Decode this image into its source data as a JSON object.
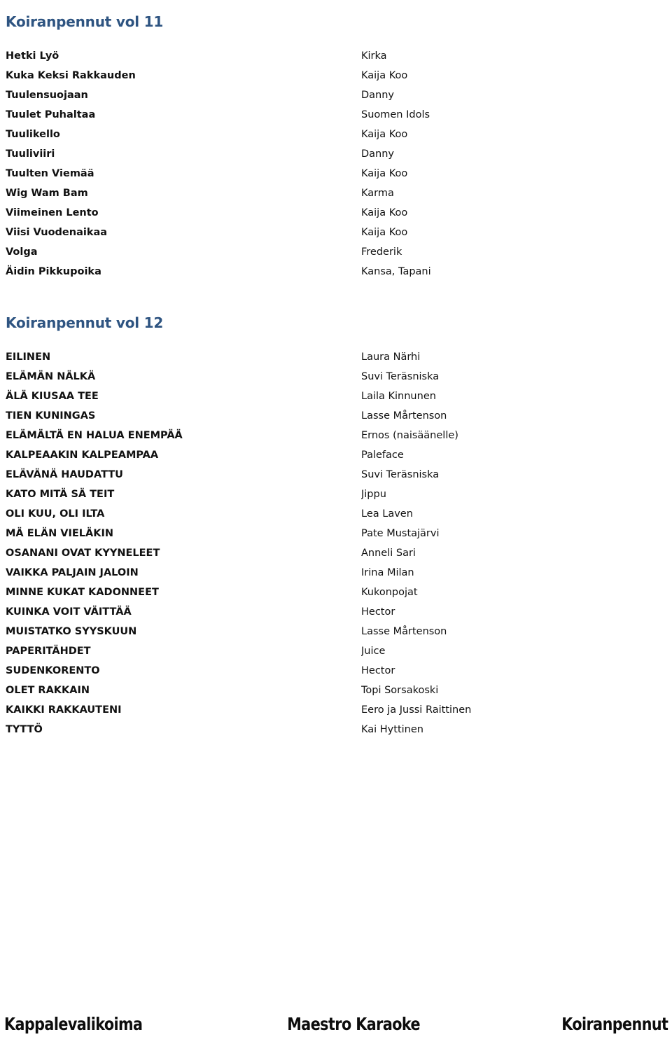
{
  "document": {
    "sections": [
      {
        "id": "vol11",
        "title": "Koiranpennut vol 11",
        "tracks": [
          {
            "title": "Hetki Lyö",
            "artist": "Kirka"
          },
          {
            "title": "Kuka Keksi Rakkauden",
            "artist": "Kaija Koo"
          },
          {
            "title": "Tuulensuojaan",
            "artist": "Danny"
          },
          {
            "title": "Tuulet Puhaltaa",
            "artist": "Suomen Idols"
          },
          {
            "title": "Tuulikello",
            "artist": "Kaija Koo"
          },
          {
            "title": "Tuuliviiri",
            "artist": "Danny"
          },
          {
            "title": "Tuulten Viemää",
            "artist": "Kaija Koo"
          },
          {
            "title": "Wig Wam Bam",
            "artist": "Karma"
          },
          {
            "title": "Viimeinen Lento",
            "artist": "Kaija Koo"
          },
          {
            "title": "Viisi Vuodenaikaa",
            "artist": "Kaija Koo"
          },
          {
            "title": "Volga",
            "artist": "Frederik"
          },
          {
            "title": "Äidin Pikkupoika",
            "artist": "Kansa, Tapani"
          }
        ]
      },
      {
        "id": "vol12",
        "title": "Koiranpennut vol 12",
        "tracks": [
          {
            "title": "EILINEN",
            "artist": "Laura Närhi"
          },
          {
            "title": "ELÄMÄN NÄLKÄ",
            "artist": "Suvi Teräsniska"
          },
          {
            "title": "ÄLÄ KIUSAA TEE",
            "artist": "Laila Kinnunen"
          },
          {
            "title": "TIEN KUNINGAS",
            "artist": "Lasse Mårtenson"
          },
          {
            "title": "ELÄMÄLTÄ EN HALUA ENEMPÄÄ",
            "artist": "Ernos (naisäänelle)"
          },
          {
            "title": "KALPEAAKIN KALPEAMPAA",
            "artist": "Paleface"
          },
          {
            "title": "ELÄVÄNÄ HAUDATTU",
            "artist": "Suvi Teräsniska"
          },
          {
            "title": "KATO MITÄ SÄ TEIT",
            "artist": "Jippu"
          },
          {
            "title": "OLI KUU, OLI ILTA",
            "artist": "Lea Laven"
          },
          {
            "title": "MÄ ELÄN VIELÄKIN",
            "artist": "Pate Mustajärvi"
          },
          {
            "title": "OSANANI OVAT KYYNELEET",
            "artist": "Anneli Sari"
          },
          {
            "title": "VAIKKA PALJAIN JALOIN",
            "artist": "Irina Milan"
          },
          {
            "title": "MINNE KUKAT KADONNEET",
            "artist": "Kukonpojat"
          },
          {
            "title": "KUINKA VOIT VÄITTÄÄ",
            "artist": "Hector"
          },
          {
            "title": "MUISTATKO SYYSKUUN",
            "artist": "Lasse Mårtenson"
          },
          {
            "title": "PAPERITÄHDET",
            "artist": "Juice"
          },
          {
            "title": "SUDENKORENTO",
            "artist": "Hector"
          },
          {
            "title": "OLET RAKKAIN",
            "artist": "Topi Sorsakoski"
          },
          {
            "title": "KAIKKI RAKKAUTENI",
            "artist": "Eero ja Jussi Raittinen"
          },
          {
            "title": "TYTTÖ",
            "artist": "Kai Hyttinen"
          }
        ]
      }
    ]
  },
  "footer": {
    "left": "Kappalevalikoima",
    "center": "Maestro Karaoke",
    "right": "Koiranpennut"
  },
  "colors": {
    "heading": "#2e5481",
    "text": "#111111",
    "background": "#ffffff"
  }
}
